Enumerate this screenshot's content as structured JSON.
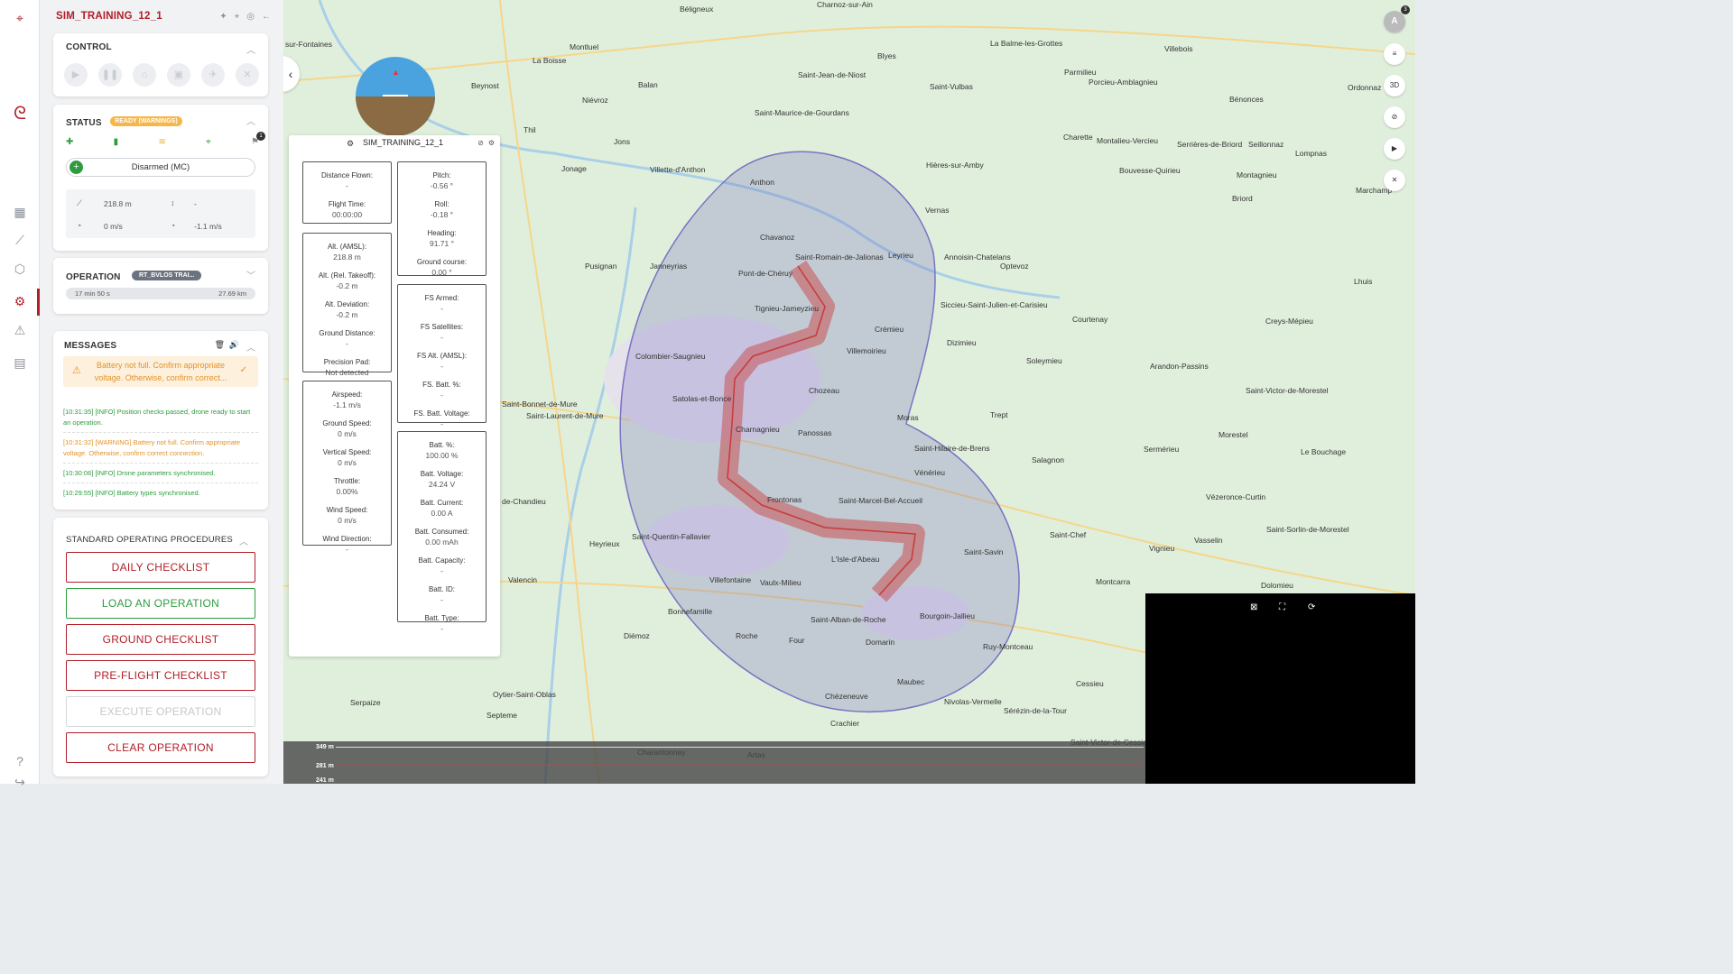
{
  "drone_name": "SIM_TRAINING_12_1",
  "control": {
    "title": "CONTROL"
  },
  "status": {
    "title": "STATUS",
    "badge": "READY (WARNINGS)",
    "notif_count": "1",
    "arm_state": "Disarmed (MC)",
    "altitude": "218.8 m",
    "vertical": "-",
    "speed": "0 m/s",
    "vspeed": "-1.1 m/s"
  },
  "operation": {
    "title": "OPERATION",
    "badge": "RT_BVLOS TRAI...",
    "duration": "17 min  50 s",
    "distance": "27.69  km"
  },
  "messages": {
    "title": "MESSAGES",
    "warning": "Battery not full. Confirm appropriate voltage. Otherwise, confirm correct...",
    "logs": [
      {
        "text": "[10:31:35] [INFO] Position checks passed, drone ready to start an operation.",
        "color": "#2e9c3e"
      },
      {
        "text": "[10:31:32] [WARNING] Battery not full. Confirm appropriate voltage. Otherwise, confirm correct connection.",
        "color": "#e3932a"
      },
      {
        "text": "[10:30:06] [INFO] Drone parameters synchronised.",
        "color": "#2e9c3e"
      },
      {
        "text": "[10:29:55] [INFO] Battery types synchronised.",
        "color": "#2e9c3e"
      }
    ]
  },
  "sop": {
    "title": "STANDARD OPERATING PROCEDURES",
    "buttons": [
      "DAILY CHECKLIST",
      "LOAD AN OPERATION",
      "GROUND CHECKLIST",
      "PRE-FLIGHT CHECKLIST",
      "EXECUTE OPERATION",
      "CLEAR OPERATION"
    ]
  },
  "drone_panel": {
    "flight": [
      [
        "Distance Flown:",
        "-"
      ],
      [
        "Flight Time:",
        "00:00:00"
      ]
    ],
    "altitude": [
      [
        "Alt. (AMSL):",
        "218.8 m"
      ],
      [
        "Alt. (Rel. Takeoff):",
        "-0.2 m"
      ],
      [
        "Alt. Deviation:",
        "-0.2 m"
      ],
      [
        "Ground Distance:",
        "-"
      ],
      [
        "Precision Pad:",
        "Not detected"
      ]
    ],
    "speed": [
      [
        "Airspeed:",
        "-1.1 m/s"
      ],
      [
        "Ground Speed:",
        "0 m/s"
      ],
      [
        "Vertical Speed:",
        "0 m/s"
      ],
      [
        "Throttle:",
        "0.00%"
      ],
      [
        "Wind Speed:",
        "0 m/s"
      ],
      [
        "Wind Direction:",
        "-"
      ]
    ],
    "attitude": [
      [
        "Pitch:",
        "-0.56 °"
      ],
      [
        "Roll:",
        "-0.18 °"
      ],
      [
        "Heading:",
        "91.71 °"
      ],
      [
        "Ground course:",
        "0.00 °"
      ]
    ],
    "failsafe": [
      [
        "FS Armed:",
        "-"
      ],
      [
        "FS Satellites:",
        "-"
      ],
      [
        "FS Alt. (AMSL):",
        "-"
      ],
      [
        "FS. Batt. %:",
        "-"
      ],
      [
        "FS. Batt. Voltage:",
        "-"
      ]
    ],
    "battery": [
      [
        "Batt. %:",
        "100.00 %"
      ],
      [
        "Batt. Voltage:",
        "24.24 V"
      ],
      [
        "Batt. Current:",
        "0.00 A"
      ],
      [
        "Batt. Consumed:",
        "0.00 mAh"
      ],
      [
        "Batt. Capacity:",
        "-"
      ],
      [
        "Batt. ID:",
        "-"
      ],
      [
        "Batt. Type:",
        "-"
      ]
    ]
  },
  "map_controls": {
    "avatar": "A",
    "avatar_badge": "3",
    "view_3d": "3D"
  },
  "elevation": {
    "labels": [
      "349 m",
      "281 m",
      "241 m"
    ]
  },
  "towns": [
    [
      "Béligneux",
      753,
      5
    ],
    [
      "Charnoz-sur-Ain",
      905,
      0
    ],
    [
      "sur-Fontaines",
      316,
      44
    ],
    [
      "Montluel",
      631,
      47
    ],
    [
      "Blyes",
      972,
      57
    ],
    [
      "La Balme-les-Grottes",
      1097,
      43
    ],
    [
      "Villebois",
      1290,
      49
    ],
    [
      "La Boisse",
      590,
      62
    ],
    [
      "Parmilieu",
      1179,
      75
    ],
    [
      "Saint-Jean-de-Niost",
      884,
      78
    ],
    [
      "Porcieu-Amblagnieu",
      1206,
      86
    ],
    [
      "Ordonnaz",
      1493,
      92
    ],
    [
      "Beynost",
      522,
      90
    ],
    [
      "Balan",
      707,
      89
    ],
    [
      "Saint-Vulbas",
      1030,
      91
    ],
    [
      "Bénonces",
      1362,
      105
    ],
    [
      "Niévroz",
      645,
      106
    ],
    [
      "Saint-Maurice-de-Gourdans",
      836,
      120
    ],
    [
      "Thil",
      580,
      139
    ],
    [
      "Charette",
      1178,
      147
    ],
    [
      "Montalieu-Vercieu",
      1215,
      151
    ],
    [
      "Serrières-de-Briord",
      1304,
      155
    ],
    [
      "Seillonnaz",
      1383,
      155
    ],
    [
      "Jons",
      680,
      152
    ],
    [
      "Hières-sur-Amby",
      1026,
      178
    ],
    [
      "Bouvesse-Quirieu",
      1240,
      184
    ],
    [
      "Montagnieu",
      1370,
      189
    ],
    [
      "Lompnas",
      1435,
      165
    ],
    [
      "Marchamp",
      1502,
      206
    ],
    [
      "Jonage",
      622,
      182
    ],
    [
      "Villette-d'Anthon",
      720,
      183
    ],
    [
      "Anthon",
      831,
      197
    ],
    [
      "Briord",
      1365,
      215
    ],
    [
      "Vernas",
      1025,
      228
    ],
    [
      "Chavanoz",
      842,
      258
    ],
    [
      "Saint-Romain-de-Jalionas",
      881,
      280
    ],
    [
      "Leyrieu",
      984,
      278
    ],
    [
      "Annoisin-Chatelans",
      1046,
      280
    ],
    [
      "Pusignan",
      648,
      290
    ],
    [
      "Janneyrias",
      720,
      290
    ],
    [
      "Optevoz",
      1108,
      290
    ],
    [
      "Pont-de-Chéruy",
      818,
      298
    ],
    [
      "Lhuis",
      1500,
      307
    ],
    [
      "Siccieu-Saint-Julien-et-Carisieu",
      1042,
      333
    ],
    [
      "Tignieu-Jameyzieu",
      836,
      337
    ],
    [
      "Courtenay",
      1188,
      349
    ],
    [
      "Creys-Mépieu",
      1402,
      351
    ],
    [
      "Crémieu",
      969,
      360
    ],
    [
      "Dizimieu",
      1049,
      375
    ],
    [
      "Villemoirieu",
      938,
      384
    ],
    [
      "Colombier-Saugnieu",
      704,
      390
    ],
    [
      "Soleymieu",
      1137,
      395
    ],
    [
      "Arandon-Passins",
      1274,
      401
    ],
    [
      "Chozeau",
      896,
      428
    ],
    [
      "Saint-Victor-de-Morestel",
      1380,
      428
    ],
    [
      "Satolas-et-Bonce",
      745,
      437
    ],
    [
      "Saint-Bonnet-de-Mure",
      556,
      443
    ],
    [
      "Moras",
      994,
      458
    ],
    [
      "Trept",
      1097,
      455
    ],
    [
      "Saint-Laurent-de-Mure",
      583,
      456
    ],
    [
      "Charnagnieu",
      815,
      471
    ],
    [
      "Panossas",
      884,
      475
    ],
    [
      "Morestel",
      1350,
      477
    ],
    [
      "Saint-Hilaire-de-Brens",
      1013,
      492
    ],
    [
      "Sermérieu",
      1267,
      493
    ],
    [
      "Le Bouchage",
      1441,
      496
    ],
    [
      "Salagnon",
      1143,
      505
    ],
    [
      "Vénérieu",
      1013,
      519
    ],
    [
      "Frontonas",
      850,
      549
    ],
    [
      "Saint-Marcel-Bel-Accueil",
      929,
      550
    ],
    [
      "Vézeronce-Curtin",
      1336,
      546
    ],
    [
      "de-Chandieu",
      556,
      551
    ],
    [
      "Saint-Chef",
      1163,
      588
    ],
    [
      "Saint-Sorlin-de-Morestel",
      1403,
      582
    ],
    [
      "Saint-Quentin-Fallavier",
      700,
      590
    ],
    [
      "Vasselin",
      1323,
      594
    ],
    [
      "Heyrieux",
      653,
      598
    ],
    [
      "Saint-Savin",
      1068,
      607
    ],
    [
      "Vignieu",
      1273,
      603
    ],
    [
      "L'Isle-d'Abeau",
      921,
      615
    ],
    [
      "Villefontaine",
      786,
      638
    ],
    [
      "Vaulx-Milieu",
      842,
      641
    ],
    [
      "Valencin",
      563,
      638
    ],
    [
      "Montcarra",
      1214,
      640
    ],
    [
      "Dolomieu",
      1397,
      644
    ],
    [
      "Bonnefamille",
      740,
      673
    ],
    [
      "Bourgoin-Jallieu",
      1019,
      678
    ],
    [
      "Saint-Alban-de-Roche",
      898,
      682
    ],
    [
      "Roche",
      815,
      700
    ],
    [
      "Diémoz",
      691,
      700
    ],
    [
      "Four",
      874,
      705
    ],
    [
      "Domarin",
      959,
      707
    ],
    [
      "Ruy-Montceau",
      1089,
      712
    ],
    [
      "Maubec",
      994,
      751
    ],
    [
      "Cessieu",
      1192,
      753
    ],
    [
      "Chèzeneuve",
      914,
      767
    ],
    [
      "Nivolas-Vermelle",
      1046,
      773
    ],
    [
      "Sérézin-de-la-Tour",
      1112,
      783
    ],
    [
      "Serpaize",
      388,
      774
    ],
    [
      "Septeme",
      539,
      788
    ],
    [
      "Oytier-Saint-Oblas",
      546,
      765
    ],
    [
      "Crachier",
      920,
      797
    ],
    [
      "Saint-Victor-de-Cessieu",
      1186,
      818
    ],
    [
      "Charantonnay",
      706,
      829
    ],
    [
      "Artas",
      828,
      832
    ]
  ]
}
